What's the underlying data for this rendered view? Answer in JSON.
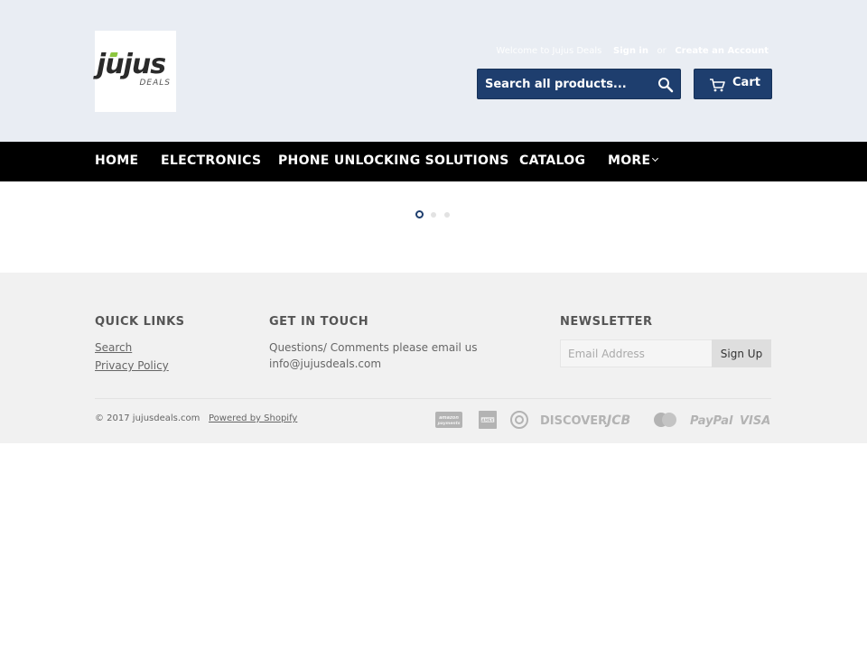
{
  "header": {
    "logo": {
      "main": "jujus",
      "sub": "DEALS"
    },
    "welcome_text": "Welcome to Jujus Deals",
    "sign_in": "Sign in",
    "or_text": "or",
    "create_account": "Create an Account",
    "search_placeholder": "Search all products...",
    "cart_label": "Cart"
  },
  "nav": {
    "items": [
      {
        "label": "HOME"
      },
      {
        "label": "ELECTRONICS"
      },
      {
        "label": "PHONE UNLOCKING SOLUTIONS"
      },
      {
        "label": "CATALOG"
      },
      {
        "label": "MORE"
      }
    ]
  },
  "slideshow": {
    "dot_count": 3,
    "active_index": 0
  },
  "footer": {
    "quick_links": {
      "heading": "QUICK LINKS",
      "links": [
        "Search",
        "Privacy Policy"
      ]
    },
    "get_in_touch": {
      "heading": "GET IN TOUCH",
      "text": "Questions/ Comments please email us",
      "email": "info@jujusdeals.com"
    },
    "newsletter": {
      "heading": "NEWSLETTER",
      "placeholder": "Email Address",
      "button": "Sign Up"
    },
    "copyright": "© 2017 jujusdeals.com",
    "powered_by": "Powered by Shopify",
    "payment_icons": [
      "amazon-payments",
      "american-express",
      "diners-club",
      "discover",
      "jcb",
      "master",
      "paypal",
      "visa"
    ],
    "payment_labels": {
      "discover": "DISCOVER",
      "jcb": "JCB",
      "paypal": "PayPal",
      "visa": "VISA",
      "amazon": "amazon payments"
    }
  },
  "colors": {
    "header_bg": "#e9edf3",
    "accent": "#1e3e6e",
    "nav_bg": "#000000",
    "footer_bg": "#f1f1f1"
  }
}
